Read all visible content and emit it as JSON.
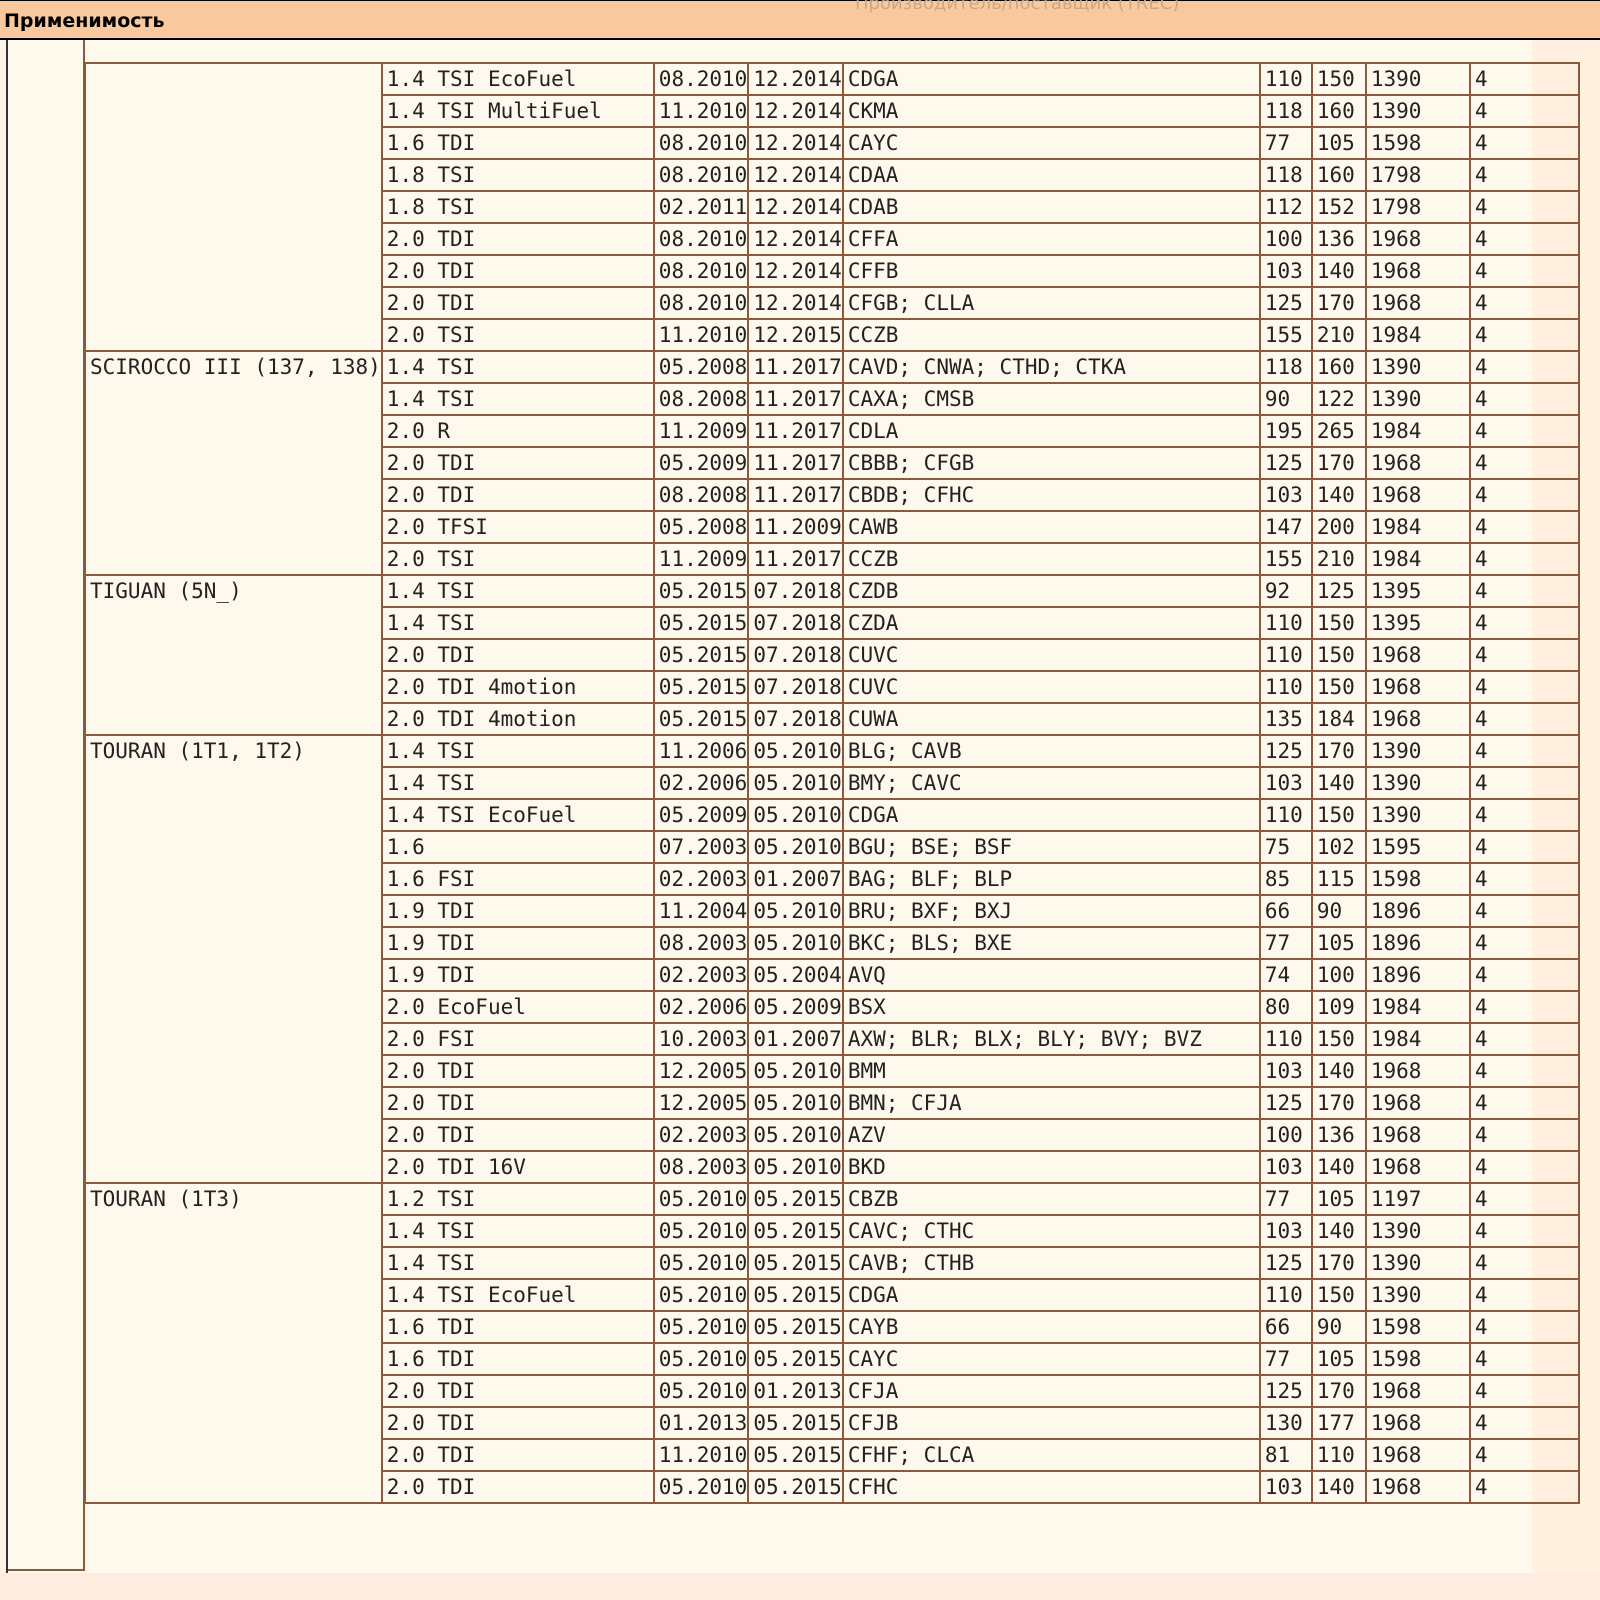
{
  "header": {
    "title": "Применимость",
    "ghost_text": "Производитель/поставщик (TREC)"
  },
  "first_row_partial": [
    "1.4 TSI EcoFuel",
    "08.2010",
    "12.2014",
    "CDGA",
    "110",
    "150",
    "1390",
    "4"
  ],
  "groups": [
    {
      "model": "",
      "rows": [
        [
          "1.4 TSI MultiFuel",
          "11.2010",
          "12.2014",
          "CKMA",
          "118",
          "160",
          "1390",
          "4"
        ],
        [
          "1.6 TDI",
          "08.2010",
          "12.2014",
          "CAYC",
          "77",
          "105",
          "1598",
          "4"
        ],
        [
          "1.8 TSI",
          "08.2010",
          "12.2014",
          "CDAA",
          "118",
          "160",
          "1798",
          "4"
        ],
        [
          "1.8 TSI",
          "02.2011",
          "12.2014",
          "CDAB",
          "112",
          "152",
          "1798",
          "4"
        ],
        [
          "2.0 TDI",
          "08.2010",
          "12.2014",
          "CFFA",
          "100",
          "136",
          "1968",
          "4"
        ],
        [
          "2.0 TDI",
          "08.2010",
          "12.2014",
          "CFFB",
          "103",
          "140",
          "1968",
          "4"
        ],
        [
          "2.0 TDI",
          "08.2010",
          "12.2014",
          "CFGB; CLLA",
          "125",
          "170",
          "1968",
          "4"
        ],
        [
          "2.0 TSI",
          "11.2010",
          "12.2015",
          "CCZB",
          "155",
          "210",
          "1984",
          "4"
        ]
      ]
    },
    {
      "model": "SCIROCCO III (137, 138)",
      "rows": [
        [
          "1.4 TSI",
          "05.2008",
          "11.2017",
          "CAVD; CNWA; CTHD; CTKA",
          "118",
          "160",
          "1390",
          "4"
        ],
        [
          "1.4 TSI",
          "08.2008",
          "11.2017",
          "CAXA; CMSB",
          "90",
          "122",
          "1390",
          "4"
        ],
        [
          "2.0 R",
          "11.2009",
          "11.2017",
          "CDLA",
          "195",
          "265",
          "1984",
          "4"
        ],
        [
          "2.0 TDI",
          "05.2009",
          "11.2017",
          "CBBB; CFGB",
          "125",
          "170",
          "1968",
          "4"
        ],
        [
          "2.0 TDI",
          "08.2008",
          "11.2017",
          "CBDB; CFHC",
          "103",
          "140",
          "1968",
          "4"
        ],
        [
          "2.0 TFSI",
          "05.2008",
          "11.2009",
          "CAWB",
          "147",
          "200",
          "1984",
          "4"
        ],
        [
          "2.0 TSI",
          "11.2009",
          "11.2017",
          "CCZB",
          "155",
          "210",
          "1984",
          "4"
        ]
      ]
    },
    {
      "model": "TIGUAN (5N_)",
      "rows": [
        [
          "1.4 TSI",
          "05.2015",
          "07.2018",
          "CZDB",
          "92",
          "125",
          "1395",
          "4"
        ],
        [
          "1.4 TSI",
          "05.2015",
          "07.2018",
          "CZDA",
          "110",
          "150",
          "1395",
          "4"
        ],
        [
          "2.0 TDI",
          "05.2015",
          "07.2018",
          "CUVC",
          "110",
          "150",
          "1968",
          "4"
        ],
        [
          "2.0 TDI 4motion",
          "05.2015",
          "07.2018",
          "CUVC",
          "110",
          "150",
          "1968",
          "4"
        ],
        [
          "2.0 TDI 4motion",
          "05.2015",
          "07.2018",
          "CUWA",
          "135",
          "184",
          "1968",
          "4"
        ]
      ]
    },
    {
      "model": "TOURAN (1T1, 1T2)",
      "rows": [
        [
          "1.4 TSI",
          "11.2006",
          "05.2010",
          "BLG; CAVB",
          "125",
          "170",
          "1390",
          "4"
        ],
        [
          "1.4 TSI",
          "02.2006",
          "05.2010",
          "BMY; CAVC",
          "103",
          "140",
          "1390",
          "4"
        ],
        [
          "1.4 TSI EcoFuel",
          "05.2009",
          "05.2010",
          "CDGA",
          "110",
          "150",
          "1390",
          "4"
        ],
        [
          "1.6",
          "07.2003",
          "05.2010",
          "BGU; BSE; BSF",
          "75",
          "102",
          "1595",
          "4"
        ],
        [
          "1.6 FSI",
          "02.2003",
          "01.2007",
          "BAG; BLF; BLP",
          "85",
          "115",
          "1598",
          "4"
        ],
        [
          "1.9 TDI",
          "11.2004",
          "05.2010",
          "BRU; BXF; BXJ",
          "66",
          "90",
          "1896",
          "4"
        ],
        [
          "1.9 TDI",
          "08.2003",
          "05.2010",
          "BKC; BLS; BXE",
          "77",
          "105",
          "1896",
          "4"
        ],
        [
          "1.9 TDI",
          "02.2003",
          "05.2004",
          "AVQ",
          "74",
          "100",
          "1896",
          "4"
        ],
        [
          "2.0 EcoFuel",
          "02.2006",
          "05.2009",
          "BSX",
          "80",
          "109",
          "1984",
          "4"
        ],
        [
          "2.0 FSI",
          "10.2003",
          "01.2007",
          "AXW; BLR; BLX; BLY; BVY; BVZ",
          "110",
          "150",
          "1984",
          "4"
        ],
        [
          "2.0 TDI",
          "12.2005",
          "05.2010",
          "BMM",
          "103",
          "140",
          "1968",
          "4"
        ],
        [
          "2.0 TDI",
          "12.2005",
          "05.2010",
          "BMN; CFJA",
          "125",
          "170",
          "1968",
          "4"
        ],
        [
          "2.0 TDI",
          "02.2003",
          "05.2010",
          "AZV",
          "100",
          "136",
          "1968",
          "4"
        ],
        [
          "2.0 TDI 16V",
          "08.2003",
          "05.2010",
          "BKD",
          "103",
          "140",
          "1968",
          "4"
        ]
      ]
    },
    {
      "model": "TOURAN (1T3)",
      "rows": [
        [
          "1.2 TSI",
          "05.2010",
          "05.2015",
          "CBZB",
          "77",
          "105",
          "1197",
          "4"
        ],
        [
          "1.4 TSI",
          "05.2010",
          "05.2015",
          "CAVC; CTHC",
          "103",
          "140",
          "1390",
          "4"
        ],
        [
          "1.4 TSI",
          "05.2010",
          "05.2015",
          "CAVB; CTHB",
          "125",
          "170",
          "1390",
          "4"
        ],
        [
          "1.4 TSI EcoFuel",
          "05.2010",
          "05.2015",
          "CDGA",
          "110",
          "150",
          "1390",
          "4"
        ],
        [
          "1.6 TDI",
          "05.2010",
          "05.2015",
          "CAYB",
          "66",
          "90",
          "1598",
          "4"
        ],
        [
          "1.6 TDI",
          "05.2010",
          "05.2015",
          "CAYC",
          "77",
          "105",
          "1598",
          "4"
        ],
        [
          "2.0 TDI",
          "05.2010",
          "01.2013",
          "CFJA",
          "125",
          "170",
          "1968",
          "4"
        ],
        [
          "2.0 TDI",
          "01.2013",
          "05.2015",
          "CFJB",
          "130",
          "177",
          "1968",
          "4"
        ],
        [
          "2.0 TDI",
          "11.2010",
          "05.2015",
          "CFHF; CLCA",
          "81",
          "110",
          "1968",
          "4"
        ],
        [
          "2.0 TDI",
          "05.2010",
          "05.2015",
          "CFHC",
          "103",
          "140",
          "1968",
          "4"
        ]
      ]
    }
  ]
}
